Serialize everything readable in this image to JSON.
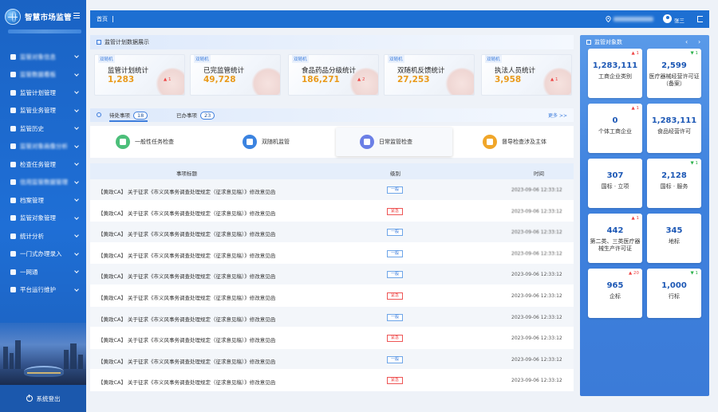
{
  "app": {
    "title": "智慧市场监管"
  },
  "sidebar": {
    "items": [
      {
        "label": "监管对象信息",
        "blurred": true
      },
      {
        "label": "监管数据看板",
        "blurred": true
      },
      {
        "label": "监管计划管理",
        "blurred": false
      },
      {
        "label": "监管业务管理",
        "blurred": false
      },
      {
        "label": "监管历史",
        "blurred": false
      },
      {
        "label": "监管对象画像分析",
        "blurred": true
      },
      {
        "label": "检查任务管理",
        "blurred": false
      },
      {
        "label": "信用监管数据管理",
        "blurred": true
      },
      {
        "label": "档案管理",
        "blurred": false
      },
      {
        "label": "监管对象管理",
        "blurred": false
      },
      {
        "label": "统计分析",
        "blurred": false
      },
      {
        "label": "一门式办理录入",
        "blurred": false
      },
      {
        "label": "一网通",
        "blurred": false
      },
      {
        "label": "平台运行维护",
        "blurred": false
      }
    ],
    "logout_label": "系统登出"
  },
  "topbar": {
    "breadcrumb": "首页",
    "user": "张三"
  },
  "plan": {
    "title": "监管计划数据展示",
    "cards": [
      {
        "tag": "双随机",
        "name": "监管计划统计",
        "value": "1,283",
        "delta": "1"
      },
      {
        "tag": "双随机",
        "name": "已完监管统计",
        "value": "49,728",
        "delta": ""
      },
      {
        "tag": "双随机",
        "name": "食品药品分级统计",
        "value": "186,271",
        "delta": "2"
      },
      {
        "tag": "双随机",
        "name": "双随机反馈统计",
        "value": "27,253",
        "delta": ""
      },
      {
        "tag": "双随机",
        "name": "执法人员统计",
        "value": "3,958",
        "delta": "1"
      }
    ]
  },
  "todo": {
    "tabs": [
      {
        "label": "待处事项",
        "count": "18"
      },
      {
        "label": "已办事项",
        "count": "23"
      }
    ],
    "more": "更多 >>",
    "categories": [
      {
        "label": "一般性任务检查",
        "color": "#4cbf7a"
      },
      {
        "label": "双随机监管",
        "color": "#3b83e0"
      },
      {
        "label": "日常监管检查",
        "color": "#6b7fe6"
      },
      {
        "label": "督导检查涉及主体",
        "color": "#f0a62a"
      }
    ],
    "columns": {
      "title": "事项标题",
      "level": "级别",
      "time": "时间"
    },
    "rows": [
      {
        "title": "【黄政CA】 关于征求《市义风事务调查处理规定（征求意见稿）》修改意见函",
        "level": "一般",
        "urgent": false,
        "time": "2023-09-06 12:33:12"
      },
      {
        "title": "【黄政CA】 关于征求《市义风事务调查处理规定（征求意见稿）》修改意见函",
        "level": "紧急",
        "urgent": true,
        "time": "2023-09-06 12:33:12"
      },
      {
        "title": "【黄政CA】 关于征求《市义风事务调查处理规定（征求意见稿）》修改意见函",
        "level": "一般",
        "urgent": false,
        "time": "2023-09-06 12:33:12"
      },
      {
        "title": "【黄政CA】 关于征求《市义风事务调查处理规定（征求意见稿）》修改意见函",
        "level": "一般",
        "urgent": false,
        "time": "2023-09-06 12:33:12"
      },
      {
        "title": "【黄政CA】 关于征求《市义风事务调查处理规定（征求意见稿）》修改意见函",
        "level": "一般",
        "urgent": false,
        "time": "2023-09-06 12:33:12"
      },
      {
        "title": "【黄政CA】 关于征求《市义风事务调查处理规定（征求意见稿）》修改意见函",
        "level": "紧急",
        "urgent": true,
        "time": "2023-09-06 12:33:12"
      },
      {
        "title": "【黄政CA】 关于征求《市义风事务调查处理规定（征求意见稿）》修改意见函",
        "level": "一般",
        "urgent": false,
        "time": "2023-09-06 12:33:12"
      },
      {
        "title": "【黄政CA】 关于征求《市义风事务调查处理规定（征求意见稿）》修改意见函",
        "level": "紧急",
        "urgent": true,
        "time": "2023-09-06 12:33:12"
      },
      {
        "title": "【黄政CA】 关于征求《市义风事务调查处理规定（征求意见稿）》修改意见函",
        "level": "一般",
        "urgent": false,
        "time": "2023-09-06 12:33:12"
      },
      {
        "title": "【黄政CA】 关于征求《市义风事务调查处理规定（征求意见稿）》修改意见函",
        "level": "紧急",
        "urgent": true,
        "time": "2023-09-06 12:33:12"
      }
    ]
  },
  "stats": {
    "title": "监管对象数",
    "cards": [
      {
        "value": "1,283,111",
        "label": "工商企业类别",
        "badge": "1",
        "trend": "up"
      },
      {
        "value": "2,599",
        "label": "医疗器械经营许可证（备案）",
        "badge": "1",
        "trend": "down"
      },
      {
        "value": "0",
        "label": "个体工商企业",
        "badge": "1",
        "trend": "up"
      },
      {
        "value": "1,283,111",
        "label": "食品经营许可",
        "badge": "",
        "trend": ""
      },
      {
        "value": "307",
        "label": "国标 · 立项",
        "badge": "",
        "trend": ""
      },
      {
        "value": "2,128",
        "label": "国标 · 服务",
        "badge": "1",
        "trend": "down"
      },
      {
        "value": "442",
        "label": "第二类、三类医疗器械生产许可证",
        "badge": "1",
        "trend": "up"
      },
      {
        "value": "345",
        "label": "地标",
        "badge": "",
        "trend": ""
      },
      {
        "value": "965",
        "label": "企标",
        "badge": "20",
        "trend": "up"
      },
      {
        "value": "1,000",
        "label": "行标",
        "badge": "1",
        "trend": "down"
      }
    ]
  }
}
